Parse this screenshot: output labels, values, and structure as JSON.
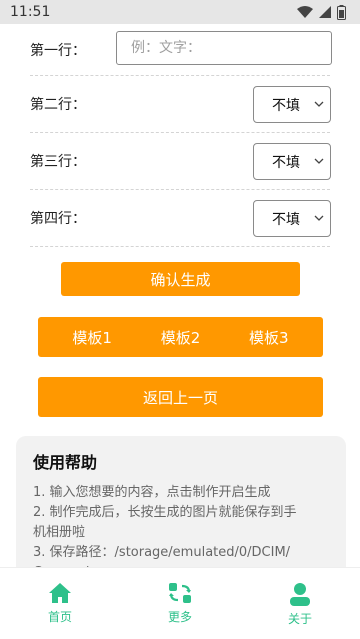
{
  "status_bar": {
    "time": "11:51",
    "icons": [
      "wifi-icon",
      "signal-icon",
      "battery-icon"
    ]
  },
  "form": {
    "rows": [
      {
        "label": "第一行：",
        "placeholder": "例：文字："
      },
      {
        "label": "第二行：",
        "value": "不填"
      },
      {
        "label": "第三行：",
        "value": "不填"
      },
      {
        "label": "第四行：",
        "value": "不填"
      }
    ]
  },
  "actions": {
    "confirm": "确认生成",
    "templates": [
      "模板1",
      "模板2",
      "模板3"
    ],
    "back": "返回上一页"
  },
  "help": {
    "title": "使用帮助",
    "lines": [
      "1. 输入您想要的内容，点击制作开启生成",
      "2. 制作完成后，长按生成的图片就能保存到手",
      "机相册啦",
      "3. 保存路径：/storage/emulated/0/DCIM/",
      "Camera/"
    ]
  },
  "bottom_nav": [
    {
      "label": "首页",
      "icon": "home-icon"
    },
    {
      "label": "更多",
      "icon": "more-icon"
    },
    {
      "label": "关于",
      "icon": "user-icon"
    }
  ],
  "colors": {
    "accent": "#ff9800",
    "nav": "#2ec08a"
  }
}
